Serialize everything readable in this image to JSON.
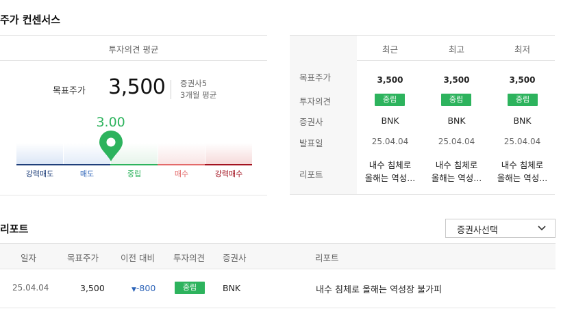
{
  "consensus": {
    "title": "주가 컨센서스",
    "avg_header": "투자의견 평균",
    "target_label": "목표주가",
    "target_value": "3,500",
    "brokers": "증권사5",
    "period": "3개월 평균",
    "score": "3.00",
    "score_fraction": 0.4,
    "scale": [
      "강력매도",
      "매도",
      "중립",
      "매수",
      "강력매수"
    ],
    "colors": {
      "accent": "#2db35d",
      "sell": "#1f4f9c",
      "buy": "#d9534f",
      "strong_buy": "#b3121f"
    }
  },
  "summary_table": {
    "columns": [
      "최근",
      "최고",
      "최저"
    ],
    "row_labels": [
      "목표주가",
      "투자의견",
      "증권사",
      "발표일",
      "리포트"
    ],
    "cols": [
      {
        "target": "3,500",
        "opinion": "중립",
        "broker": "BNK",
        "date": "25.04.04",
        "report_l1": "내수 침체로",
        "report_l2": "올해는 역성..."
      },
      {
        "target": "3,500",
        "opinion": "중립",
        "broker": "BNK",
        "date": "25.04.04",
        "report_l1": "내수 침체로",
        "report_l2": "올해는 역성..."
      },
      {
        "target": "3,500",
        "opinion": "중립",
        "broker": "BNK",
        "date": "25.04.04",
        "report_l1": "내수 침체로",
        "report_l2": "올해는 역성..."
      }
    ]
  },
  "report": {
    "title": "리포트",
    "broker_select": "증권사선택",
    "headers": [
      "일자",
      "목표주가",
      "이전 대비",
      "투자의견",
      "증권사",
      "리포트"
    ],
    "rows": [
      {
        "date": "25.04.04",
        "target": "3,500",
        "change": "-800",
        "opinion": "중립",
        "broker": "BNK",
        "title": "내수 침체로 올해는 역성장 불가피"
      }
    ]
  }
}
